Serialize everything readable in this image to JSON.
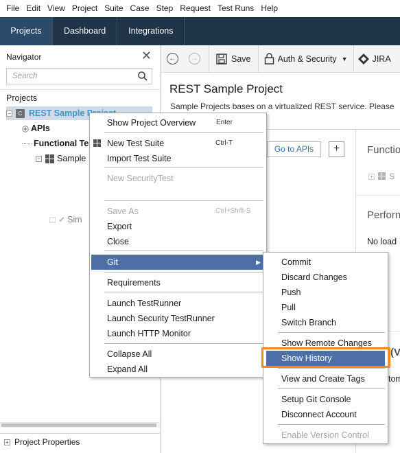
{
  "menubar": [
    "File",
    "Edit",
    "View",
    "Project",
    "Suite",
    "Case",
    "Step",
    "Request",
    "Test Runs",
    "Help"
  ],
  "tabs": [
    "Projects",
    "Dashboard",
    "Integrations"
  ],
  "navigator": {
    "title": "Navigator",
    "search_placeholder": "Search",
    "projects_label": "Projects",
    "tree": {
      "project": "REST Sample Project",
      "apis": "APIs",
      "functional": "Functional Te",
      "suite": "Sample",
      "case": "Sim"
    },
    "footer": "Project Properties"
  },
  "toolbar": {
    "save": "Save",
    "auth": "Auth & Security",
    "jira": "JIRA"
  },
  "main": {
    "title": "REST Sample Project",
    "description": "Sample Projects bases on a virtualized REST service. Please",
    "goto_apis": "Go to APIs",
    "functional_head": "Functio",
    "functional_item": "S",
    "performance_head": "Perforn",
    "no_load": "No load",
    "partial_v": "(V",
    "partial_tom": "tom"
  },
  "context_menu": {
    "items": [
      {
        "label": "Show Project Overview",
        "shortcut": "Enter"
      },
      {
        "label": "New Test Suite",
        "shortcut": "Ctrl-T"
      },
      {
        "label": "Import Test Suite",
        "shortcut": ""
      },
      {
        "label": "New SecurityTest",
        "shortcut": ""
      },
      {
        "label": "Save As",
        "shortcut": "Ctrl+Shift-S"
      },
      {
        "label": "Export",
        "shortcut": ""
      },
      {
        "label": "Close",
        "shortcut": ""
      },
      {
        "label": "Git",
        "shortcut": ""
      },
      {
        "label": "Requirements",
        "shortcut": ""
      },
      {
        "label": "Launch TestRunner",
        "shortcut": ""
      },
      {
        "label": "Launch Security TestRunner",
        "shortcut": ""
      },
      {
        "label": "Launch HTTP Monitor",
        "shortcut": ""
      },
      {
        "label": "Collapse All",
        "shortcut": ""
      },
      {
        "label": "Expand All",
        "shortcut": ""
      }
    ]
  },
  "git_submenu": {
    "items": [
      "Commit",
      "Discard Changes",
      "Push",
      "Pull",
      "Switch Branch",
      "Show Remote Changes",
      "Show History",
      "View and Create Tags",
      "Setup Git Console",
      "Disconnect Account",
      "Enable Version Control"
    ]
  },
  "colors": {
    "tabbar_bg": "#1f3349",
    "menu_highlight": "#4d6fa6",
    "highlight_outline": "#f08a1b",
    "project_link": "#3b95c8"
  }
}
